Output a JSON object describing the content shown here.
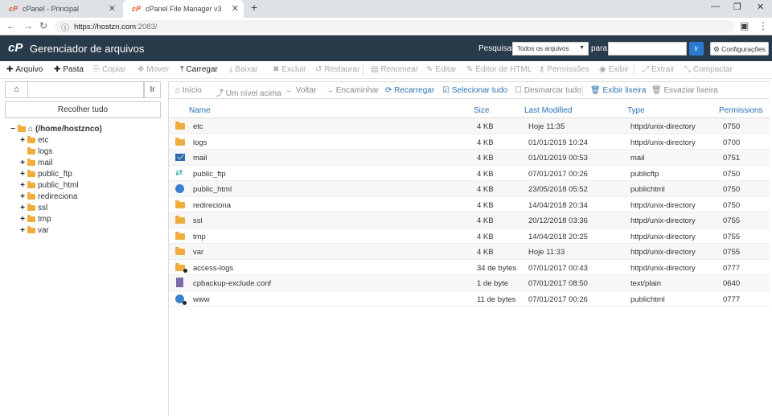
{
  "browser": {
    "tabs": [
      {
        "label": "cPanel - Principal",
        "favicon": "cP"
      },
      {
        "label": "cPanel File Manager v3",
        "favicon": "cP"
      }
    ],
    "url_host": "https://hostzn.com",
    "url_path": ":2083/"
  },
  "header": {
    "logo": "cP",
    "title": "Gerenciador de arquivos",
    "search_label": "Pesquisar",
    "search_scope": "Todos os arquivos",
    "for_label": "para",
    "go_label": "Ir",
    "settings_label": "Configurações"
  },
  "toolbar": {
    "file": "Arquivo",
    "folder": "Pasta",
    "copy": "Copiar",
    "move": "Mover",
    "upload": "Carregar",
    "download": "Baixar",
    "delete": "Excluir",
    "restore": "Restaurar",
    "rename": "Renomear",
    "edit": "Editar",
    "html_editor": "Editor de HTML",
    "permissions": "Permissões",
    "view": "Exibir",
    "extract": "Extrair",
    "compress": "Compactar"
  },
  "sidebar": {
    "go_label": "Ir",
    "collapse_label": "Recolher tudo",
    "root": "(/home/hostznco)",
    "items": [
      {
        "label": "etc",
        "expandable": true
      },
      {
        "label": "logs",
        "expandable": false
      },
      {
        "label": "mail",
        "expandable": true
      },
      {
        "label": "public_ftp",
        "expandable": true
      },
      {
        "label": "public_html",
        "expandable": true
      },
      {
        "label": "redireciona",
        "expandable": true
      },
      {
        "label": "ssl",
        "expandable": true
      },
      {
        "label": "tmp",
        "expandable": true
      },
      {
        "label": "var",
        "expandable": true
      }
    ]
  },
  "navbar": {
    "home": "Início",
    "up": "Um nível acima",
    "back": "Voltar",
    "forward": "Encaminhar",
    "reload": "Recarregar",
    "select_all": "Selecionar tudo",
    "deselect_all": "Desmarcar tudo",
    "view_trash": "Exibir lixeira",
    "empty_trash": "Esvaziar lixeira"
  },
  "table": {
    "columns": [
      "Name",
      "Size",
      "Last Modified",
      "Type",
      "Permissions"
    ],
    "rows": [
      {
        "icon": "folder",
        "name": "etc",
        "size": "4 KB",
        "modified": "Hoje 11:35",
        "type": "httpd/unix-directory",
        "perms": "0750"
      },
      {
        "icon": "folder",
        "name": "logs",
        "size": "4 KB",
        "modified": "01/01/2019 10:24",
        "type": "httpd/unix-directory",
        "perms": "0700"
      },
      {
        "icon": "mail",
        "name": "mail",
        "size": "4 KB",
        "modified": "01/01/2019 00:53",
        "type": "mail",
        "perms": "0751"
      },
      {
        "icon": "ftp",
        "name": "public_ftp",
        "size": "4 KB",
        "modified": "07/01/2017 00:26",
        "type": "publicftp",
        "perms": "0750"
      },
      {
        "icon": "globe",
        "name": "public_html",
        "size": "4 KB",
        "modified": "23/05/2018 05:52",
        "type": "publichtml",
        "perms": "0750"
      },
      {
        "icon": "folder",
        "name": "redireciona",
        "size": "4 KB",
        "modified": "14/04/2018 20:34",
        "type": "httpd/unix-directory",
        "perms": "0750"
      },
      {
        "icon": "folder",
        "name": "ssl",
        "size": "4 KB",
        "modified": "20/12/2018 03:36",
        "type": "httpd/unix-directory",
        "perms": "0755"
      },
      {
        "icon": "folder",
        "name": "tmp",
        "size": "4 KB",
        "modified": "14/04/2018 20:25",
        "type": "httpd/unix-directory",
        "perms": "0755"
      },
      {
        "icon": "folder",
        "name": "var",
        "size": "4 KB",
        "modified": "Hoje 11:33",
        "type": "httpd/unix-directory",
        "perms": "0755"
      },
      {
        "icon": "folder-link",
        "name": "access-logs",
        "size": "34 de bytes",
        "modified": "07/01/2017 00:43",
        "type": "httpd/unix-directory",
        "perms": "0777"
      },
      {
        "icon": "file",
        "name": "cpbackup-exclude.conf",
        "size": "1 de byte",
        "modified": "07/01/2017 08:50",
        "type": "text/plain",
        "perms": "0640"
      },
      {
        "icon": "globe-link",
        "name": "www",
        "size": "11 de bytes",
        "modified": "07/01/2017 00:26",
        "type": "publichtml",
        "perms": "0777"
      }
    ]
  }
}
